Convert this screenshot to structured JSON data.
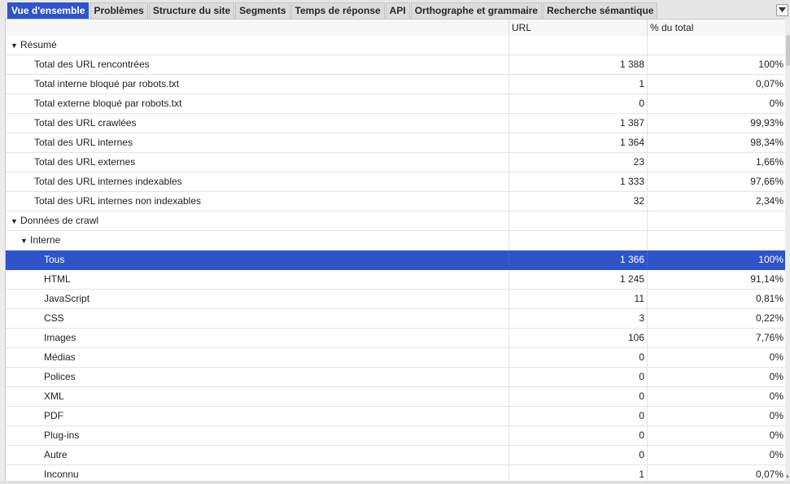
{
  "tabs": [
    {
      "label": "Vue d'ensemble",
      "active": true
    },
    {
      "label": "Problèmes"
    },
    {
      "label": "Structure du site"
    },
    {
      "label": "Segments"
    },
    {
      "label": "Temps de réponse"
    },
    {
      "label": "API"
    },
    {
      "label": "Orthographe et grammaire"
    },
    {
      "label": "Recherche sémantique"
    }
  ],
  "columns": {
    "name": "",
    "url": "URL",
    "pct": "% du total"
  },
  "rows": [
    {
      "name": "Résumé",
      "level": "group0",
      "expanded": true,
      "url": "",
      "pct": ""
    },
    {
      "name": "Total des URL rencontrées",
      "level": "leaf0",
      "url": "1 388",
      "pct": "100%"
    },
    {
      "name": "Total interne bloqué par robots.txt",
      "level": "leaf0",
      "url": "1",
      "pct": "0,07%"
    },
    {
      "name": "Total externe bloqué par robots.txt",
      "level": "leaf0",
      "url": "0",
      "pct": "0%"
    },
    {
      "name": "Total des URL crawlées",
      "level": "leaf0",
      "url": "1 387",
      "pct": "99,93%"
    },
    {
      "name": "Total des URL internes",
      "level": "leaf0",
      "url": "1 364",
      "pct": "98,34%"
    },
    {
      "name": "Total des URL externes",
      "level": "leaf0",
      "url": "23",
      "pct": "1,66%"
    },
    {
      "name": "Total des URL internes indexables",
      "level": "leaf0",
      "url": "1 333",
      "pct": "97,66%"
    },
    {
      "name": "Total des URL internes non indexables",
      "level": "leaf0",
      "url": "32",
      "pct": "2,34%"
    },
    {
      "name": "Données de crawl",
      "level": "group0",
      "expanded": true,
      "url": "",
      "pct": ""
    },
    {
      "name": "Interne",
      "level": "group1",
      "expanded": true,
      "url": "",
      "pct": ""
    },
    {
      "name": "Tous",
      "level": "leaf2",
      "url": "1 366",
      "pct": "100%",
      "selected": true
    },
    {
      "name": "HTML",
      "level": "leaf2",
      "url": "1 245",
      "pct": "91,14%"
    },
    {
      "name": "JavaScript",
      "level": "leaf2",
      "url": "11",
      "pct": "0,81%"
    },
    {
      "name": "CSS",
      "level": "leaf2",
      "url": "3",
      "pct": "0,22%"
    },
    {
      "name": "Images",
      "level": "leaf2",
      "url": "106",
      "pct": "7,76%"
    },
    {
      "name": "Médias",
      "level": "leaf2",
      "url": "0",
      "pct": "0%"
    },
    {
      "name": "Polices",
      "level": "leaf2",
      "url": "0",
      "pct": "0%"
    },
    {
      "name": "XML",
      "level": "leaf2",
      "url": "0",
      "pct": "0%"
    },
    {
      "name": "PDF",
      "level": "leaf2",
      "url": "0",
      "pct": "0%"
    },
    {
      "name": "Plug-ins",
      "level": "leaf2",
      "url": "0",
      "pct": "0%"
    },
    {
      "name": "Autre",
      "level": "leaf2",
      "url": "0",
      "pct": "0%"
    },
    {
      "name": "Inconnu",
      "level": "leaf2",
      "url": "1",
      "pct": "0,07%"
    }
  ],
  "icons": {
    "expanded": "triangle-down-icon",
    "tab_menu": "chevron-down-icon"
  },
  "colors": {
    "accent": "#2f54c8",
    "selected_text": "#ffffff"
  }
}
